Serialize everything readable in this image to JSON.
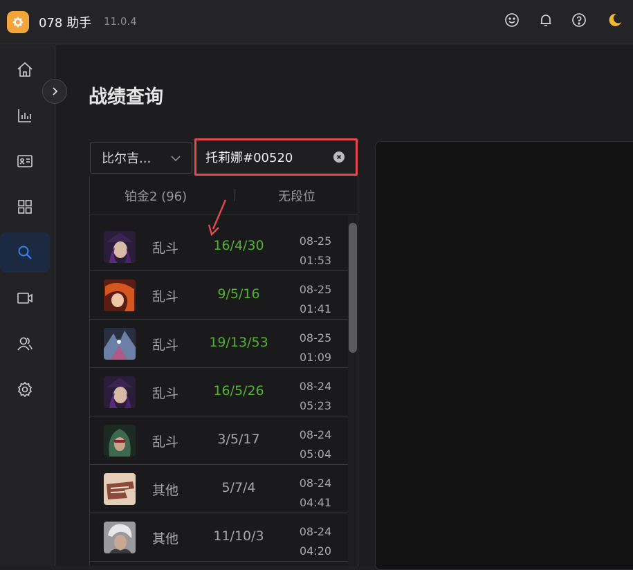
{
  "app": {
    "name": "078 助手",
    "version": "11.0.4"
  },
  "titlebar_icons": [
    "smiley-icon",
    "bell-icon",
    "help-icon",
    "moon-icon"
  ],
  "sidebar": {
    "items": [
      {
        "name": "home",
        "icon": "home-icon"
      },
      {
        "name": "stats",
        "icon": "chart-icon"
      },
      {
        "name": "profile",
        "icon": "id-card-icon"
      },
      {
        "name": "apps",
        "icon": "grid-icon"
      },
      {
        "name": "search",
        "icon": "search-icon",
        "active": true
      },
      {
        "name": "video",
        "icon": "video-icon"
      },
      {
        "name": "friends",
        "icon": "users-icon"
      },
      {
        "name": "settings",
        "icon": "gear-icon"
      }
    ]
  },
  "page": {
    "title": "战绩查询"
  },
  "search": {
    "region_value": "比尔吉...",
    "summoner_value": "托莉娜#00520"
  },
  "rank": {
    "solo": "铂金2 (96)",
    "flex": "无段位"
  },
  "matches": [
    {
      "mode": "乱斗",
      "kda": "16/4/30",
      "date": "08-25",
      "time": "01:53",
      "result": "win"
    },
    {
      "mode": "乱斗",
      "kda": "9/5/16",
      "date": "08-25",
      "time": "01:41",
      "result": "win"
    },
    {
      "mode": "乱斗",
      "kda": "19/13/53",
      "date": "08-25",
      "time": "01:09",
      "result": "win"
    },
    {
      "mode": "乱斗",
      "kda": "16/5/26",
      "date": "08-24",
      "time": "05:23",
      "result": "win"
    },
    {
      "mode": "乱斗",
      "kda": "3/5/17",
      "date": "08-24",
      "time": "05:04",
      "result": "neutral"
    },
    {
      "mode": "其他",
      "kda": "5/7/4",
      "date": "08-24",
      "time": "04:41",
      "result": "neutral"
    },
    {
      "mode": "其他",
      "kda": "11/10/3",
      "date": "08-24",
      "time": "04:20",
      "result": "neutral"
    }
  ],
  "colors": {
    "accent": "#f2a53b",
    "win": "#52b12f",
    "highlight_border": "#e8474b",
    "active_nav": "#1b2a40",
    "link_blue": "#3b82f6"
  }
}
